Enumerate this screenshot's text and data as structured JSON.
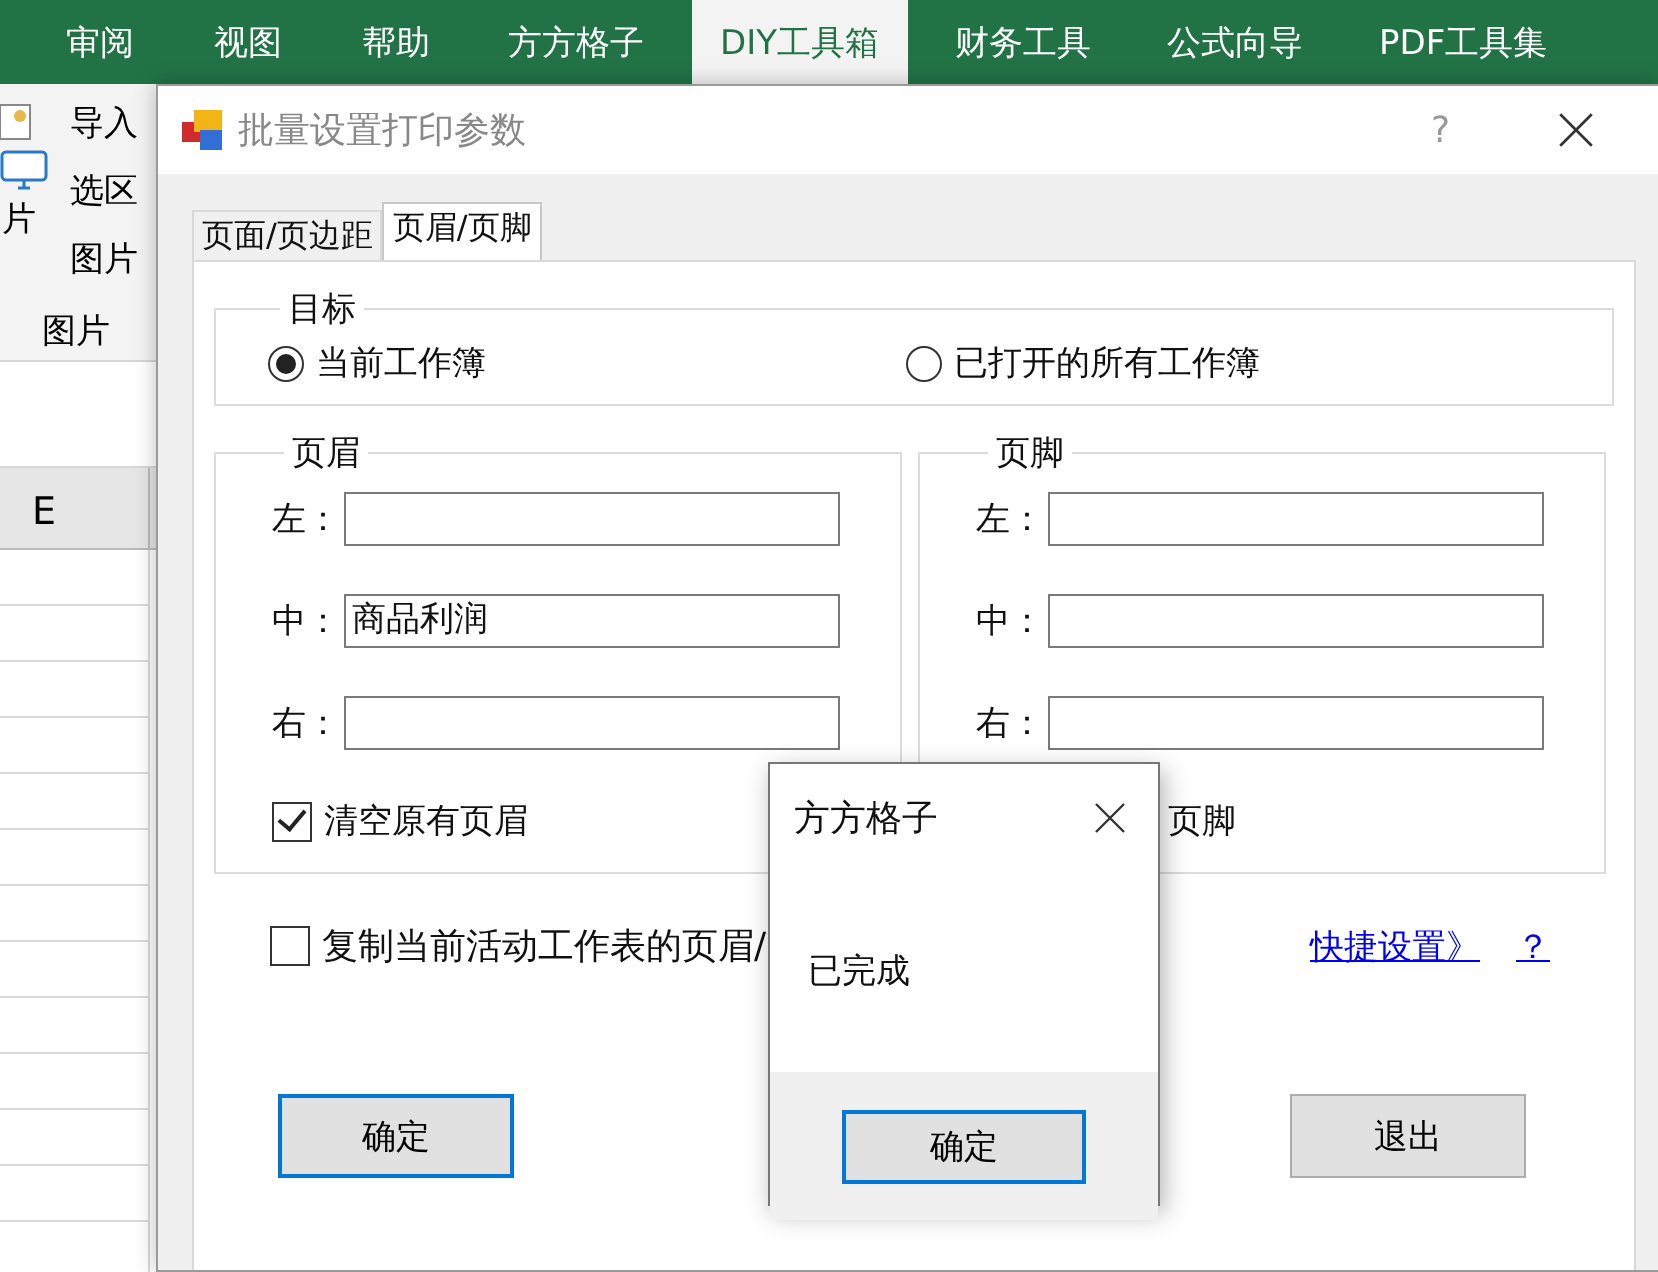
{
  "excel": {
    "ribbon_tabs": [
      {
        "label": "审阅",
        "selected": false
      },
      {
        "label": "视图",
        "selected": false
      },
      {
        "label": "帮助",
        "selected": false
      },
      {
        "label": "方方格子",
        "selected": false
      },
      {
        "label": "DIY工具箱",
        "selected": true
      },
      {
        "label": "财务工具",
        "selected": false
      },
      {
        "label": "公式向导",
        "selected": false
      },
      {
        "label": "PDF工具集",
        "selected": false
      }
    ],
    "big_button_label": "片",
    "ribbon_items": [
      "导入",
      "选区",
      "图片"
    ],
    "group_label": "图片",
    "column_header": "E"
  },
  "dialog": {
    "title": "批量设置打印参数",
    "help": "?",
    "tabs": [
      {
        "label": "页面/页边距",
        "selected": false
      },
      {
        "label": "页眉/页脚",
        "selected": true
      }
    ],
    "target": {
      "legend": "目标",
      "options": [
        {
          "label": "当前工作簿",
          "selected": true
        },
        {
          "label": "已打开的所有工作簿",
          "selected": false
        }
      ]
    },
    "header": {
      "legend": "页眉",
      "fields": [
        {
          "label": "左："
        },
        {
          "label": "中：",
          "value": "商品利润"
        },
        {
          "label": "右："
        }
      ],
      "clear": {
        "label": "清空原有页眉",
        "checked": true
      }
    },
    "footer": {
      "legend": "页脚",
      "fields": [
        {
          "label": "左："
        },
        {
          "label": "中："
        },
        {
          "label": "右："
        }
      ],
      "clear": {
        "label": "页脚"
      }
    },
    "copy": {
      "label": "复制当前活动工作表的页眉/",
      "checked": false
    },
    "links": [
      "快捷设置》",
      "？"
    ],
    "buttons": [
      {
        "label": "确定",
        "focused": true
      },
      {
        "label": "退出",
        "focused": false
      }
    ]
  },
  "message_box": {
    "title": "方方格子",
    "message": "已完成",
    "button": "确定"
  }
}
